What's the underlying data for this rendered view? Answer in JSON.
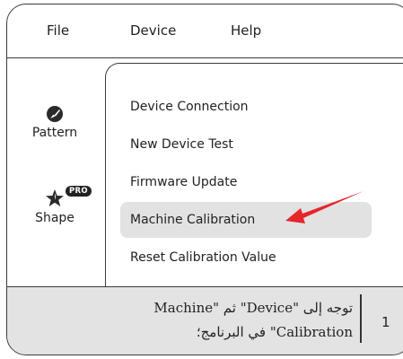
{
  "menubar": {
    "file": "File",
    "device": "Device",
    "help": "Help"
  },
  "tools": {
    "pattern": {
      "label": "Pattern",
      "icon": "pattern-brush-icon"
    },
    "shape": {
      "label": "Shape",
      "icon": "star-shape-icon",
      "badge": "PRO"
    }
  },
  "device_menu": {
    "items": [
      {
        "label": "Device Connection"
      },
      {
        "label": "New Device Test"
      },
      {
        "label": "Firmware Update"
      },
      {
        "label": "Machine Calibration",
        "highlighted": true
      },
      {
        "label": "Reset Calibration Value"
      }
    ]
  },
  "annotation": {
    "color": "#e5262b",
    "icon": "red-pointer-arrow"
  },
  "caption": {
    "line1": "توجه إلى \"Device\" ثم \"Machine",
    "line2": "Calibration\" في البرنامج؛",
    "step": "1"
  }
}
